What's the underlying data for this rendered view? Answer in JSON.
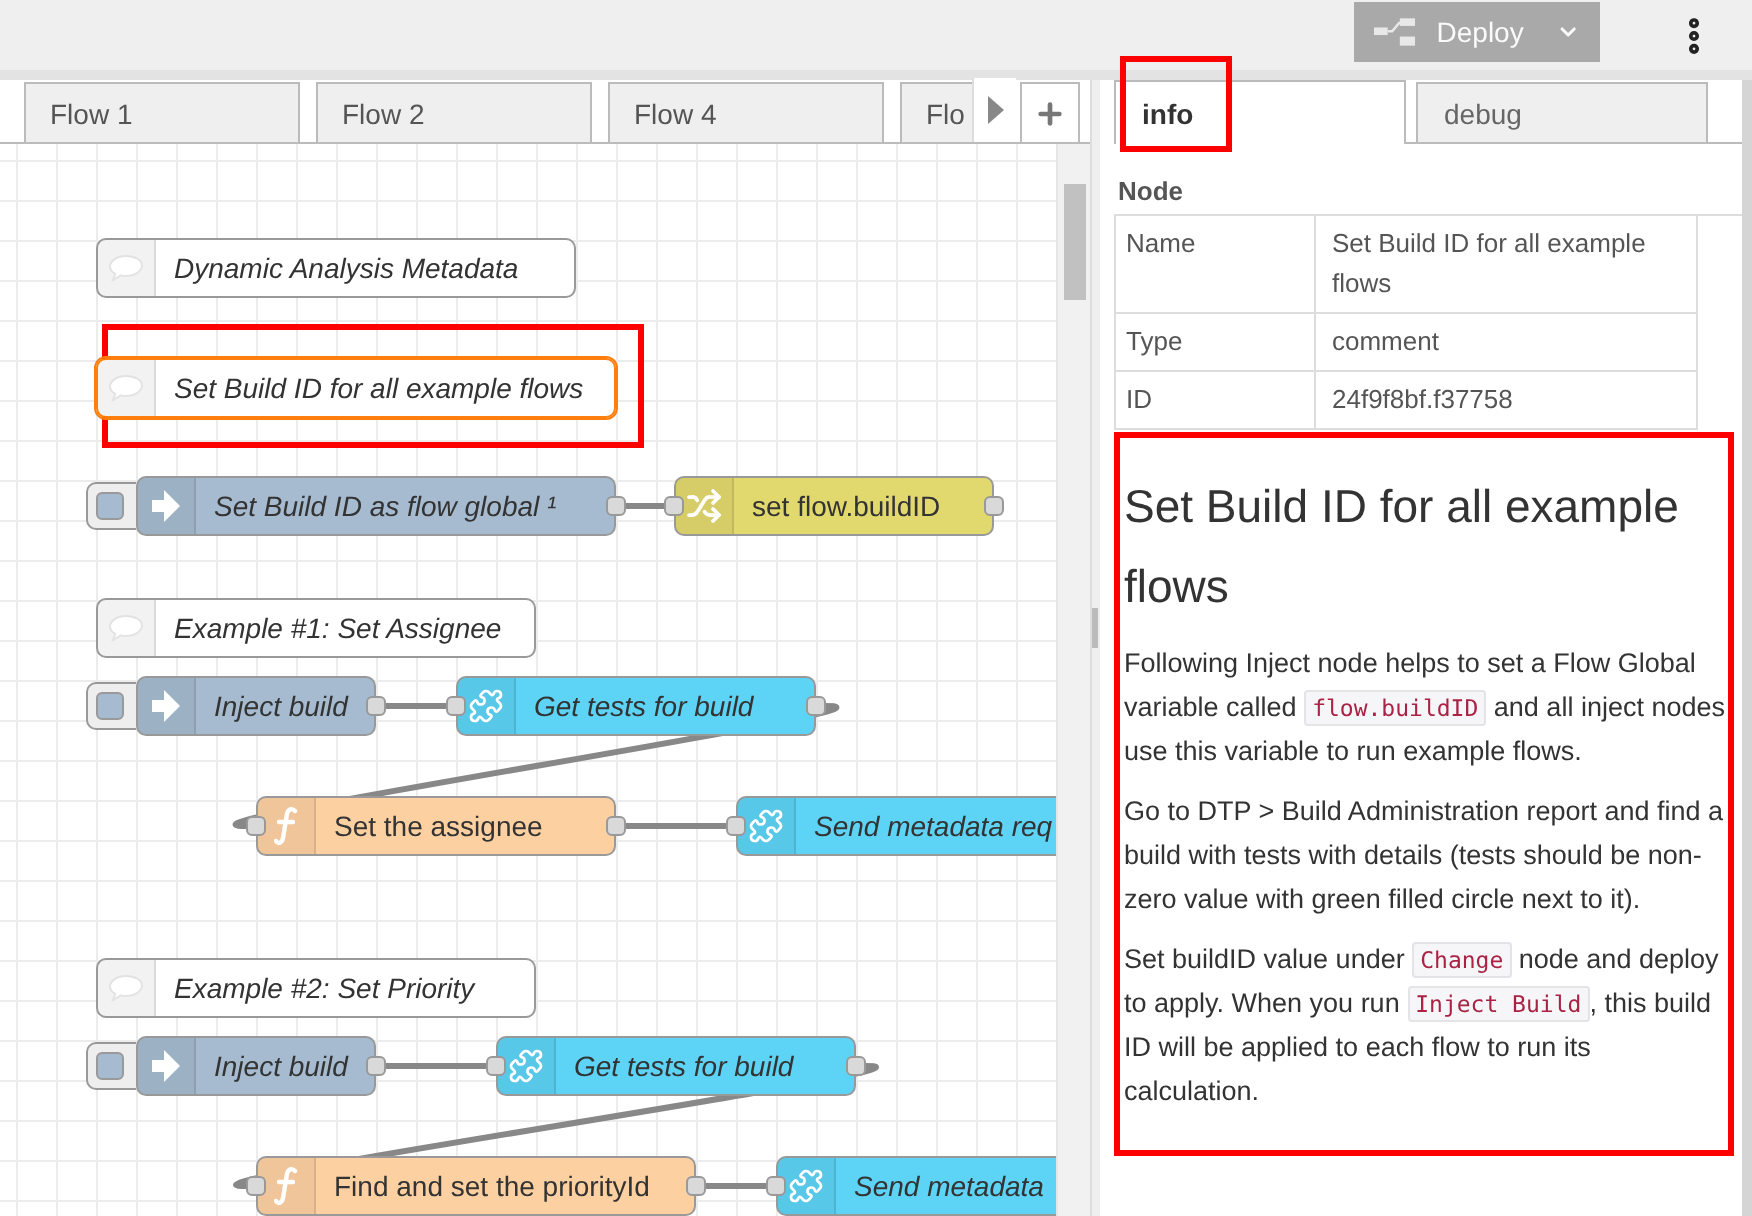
{
  "header": {
    "deploy": {
      "label": "Deploy",
      "disabled": true
    }
  },
  "workspace": {
    "tabs": [
      {
        "label": "Flow 1",
        "selected": false
      },
      {
        "label": "Flow 2",
        "selected": false
      },
      {
        "label": "Flow 4",
        "selected": false
      },
      {
        "label": "Flo",
        "selected": false
      }
    ]
  },
  "canvas": {
    "nodes": [
      {
        "kind": "comment",
        "label": "Dynamic Analysis Metadata",
        "selected": false,
        "highlighted": false
      },
      {
        "kind": "comment",
        "label": "Set Build ID for all example flows",
        "selected": true,
        "highlighted": true
      },
      {
        "kind": "inject",
        "label": "Set Build ID as flow global ¹",
        "selected": false,
        "highlighted": false
      },
      {
        "kind": "change",
        "label": "set flow.buildID",
        "selected": false,
        "highlighted": false
      },
      {
        "kind": "comment",
        "label": "Example #1: Set Assignee",
        "selected": false,
        "highlighted": false
      },
      {
        "kind": "inject",
        "label": "Inject build",
        "selected": false,
        "highlighted": false
      },
      {
        "kind": "subflow",
        "label": "Get tests for build",
        "selected": false,
        "highlighted": false
      },
      {
        "kind": "function",
        "label": "Set the assignee",
        "selected": false,
        "highlighted": false
      },
      {
        "kind": "subflow",
        "label": "Send metadata req",
        "selected": false,
        "highlighted": false
      },
      {
        "kind": "comment",
        "label": "Example #2: Set Priority",
        "selected": false,
        "highlighted": false
      },
      {
        "kind": "inject",
        "label": "Inject build",
        "selected": false,
        "highlighted": false
      },
      {
        "kind": "subflow",
        "label": "Get tests for build",
        "selected": false,
        "highlighted": false
      },
      {
        "kind": "function",
        "label": "Find and set the priorityId",
        "selected": false,
        "highlighted": false
      },
      {
        "kind": "subflow",
        "label": "Send metadata",
        "selected": false,
        "highlighted": false
      }
    ]
  },
  "sidebar": {
    "tabs": [
      {
        "label": "info",
        "selected": true,
        "highlighted": true
      },
      {
        "label": "debug",
        "selected": false,
        "highlighted": false
      }
    ],
    "node_section": {
      "title": "Node",
      "properties": [
        {
          "name": "Name",
          "value": "Set Build ID for all example flows"
        },
        {
          "name": "Type",
          "value": "comment"
        },
        {
          "name": "ID",
          "value": "24f9f8bf.f37758"
        }
      ]
    },
    "description": {
      "highlighted": true,
      "heading": "Set Build ID for all example flows",
      "paragraphs": [
        [
          {
            "kind": "text",
            "text": "Following Inject node helps to set a Flow Global variable called "
          },
          {
            "kind": "code",
            "text": "flow.buildID"
          },
          {
            "kind": "text",
            "text": " and all inject nodes use this variable to run example flows."
          }
        ],
        [
          {
            "kind": "text",
            "text": "Go to DTP > Build Administration report and find a build with tests with details (tests should be non-zero value with green filled circle next to it)."
          }
        ],
        [
          {
            "kind": "text",
            "text": "Set buildID value under "
          },
          {
            "kind": "code",
            "text": "Change"
          },
          {
            "kind": "text",
            "text": " node and deploy to apply. When you run "
          },
          {
            "kind": "code",
            "text": "Inject Build"
          },
          {
            "kind": "text",
            "text": ", this build ID will be applied to each flow to run its calculation."
          }
        ]
      ]
    }
  }
}
